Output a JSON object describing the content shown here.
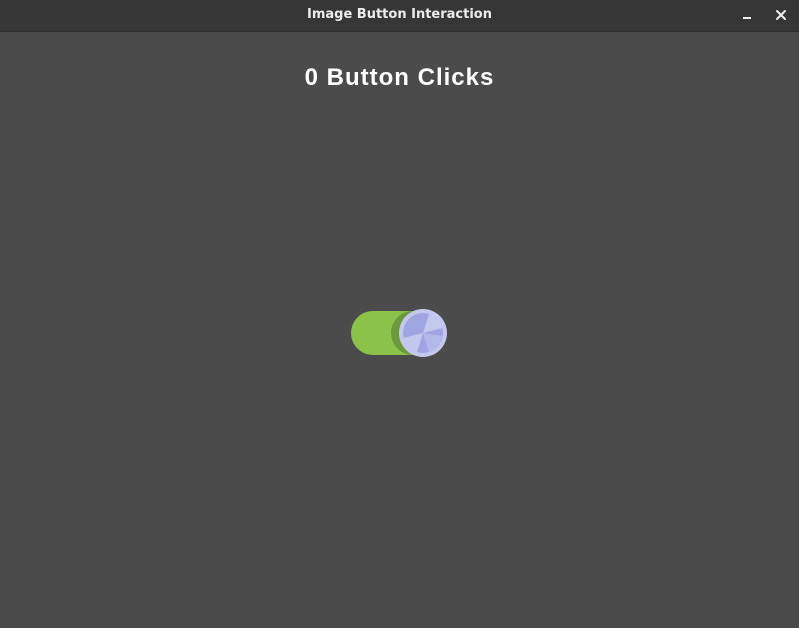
{
  "window": {
    "title": "Image Button Interaction",
    "minimize_icon": "minimize-icon",
    "close_icon": "close-icon"
  },
  "main": {
    "click_heading": "0 Button Clicks",
    "image_button": {
      "icon": "toggle-switch-icon",
      "state": "on",
      "colors": {
        "track": "#8bc34a",
        "track_shade": "#6a9a3a",
        "knob": "#c5c8ee",
        "knob_shade": "#9fa5e0"
      }
    }
  },
  "colors": {
    "background": "#4b4b4b",
    "titlebar": "#363636",
    "text": "#ffffff"
  }
}
